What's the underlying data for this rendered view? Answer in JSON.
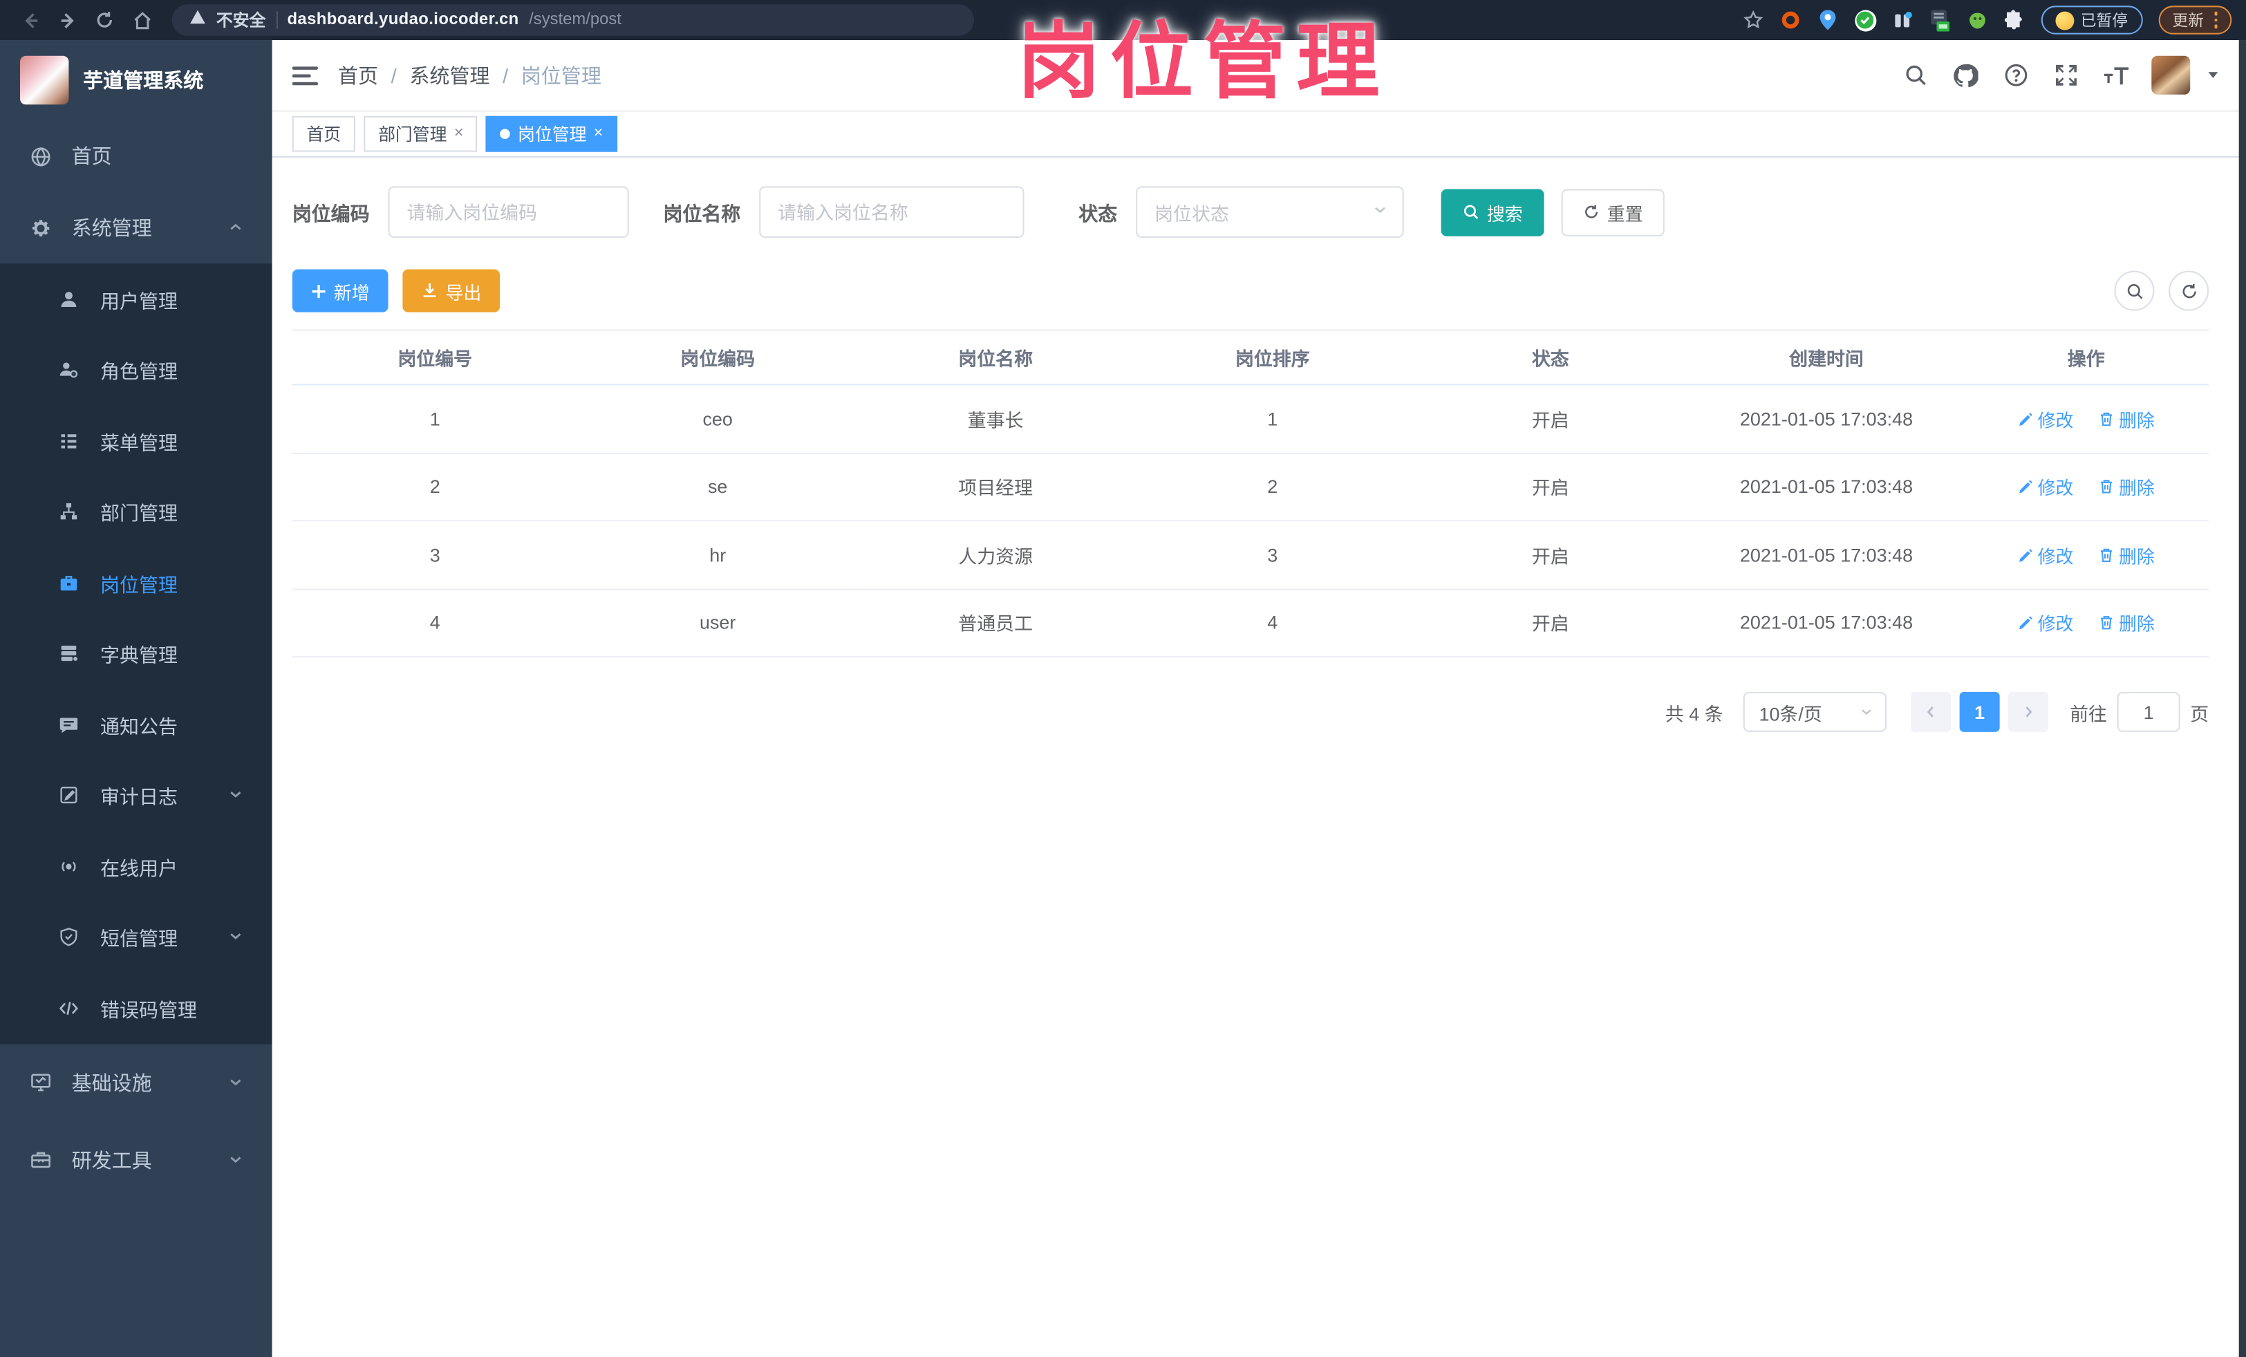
{
  "browser": {
    "security_label": "不安全",
    "url_host": "dashboard.yudao.iocoder.cn",
    "url_path": "/system/post",
    "paused_badge_label": "已暂停",
    "update_button_label": "更新"
  },
  "watermark": {
    "text": "岗位管理",
    "color": "#f4486d"
  },
  "sidebar": {
    "app_title": "芋道管理系统",
    "items_top": [
      {
        "label": "首页"
      },
      {
        "label": "系统管理"
      }
    ],
    "system_children": [
      "用户管理",
      "角色管理",
      "菜单管理",
      "部门管理",
      "岗位管理",
      "字典管理",
      "通知公告",
      "审计日志",
      "在线用户",
      "短信管理",
      "错误码管理"
    ],
    "items_bottom": [
      {
        "label": "基础设施"
      },
      {
        "label": "研发工具"
      }
    ],
    "active_item": "岗位管理"
  },
  "breadcrumb": {
    "items": [
      "首页",
      "系统管理",
      "岗位管理"
    ],
    "separator": "/"
  },
  "tabbar": {
    "close_glyph": "×",
    "tabs": [
      {
        "label": "首页",
        "active": false,
        "closable": false
      },
      {
        "label": "部门管理",
        "active": false,
        "closable": true
      },
      {
        "label": "岗位管理",
        "active": true,
        "closable": true
      }
    ]
  },
  "filter": {
    "code_label": "岗位编码",
    "code_placeholder": "请输入岗位编码",
    "name_label": "岗位名称",
    "name_placeholder": "请输入岗位名称",
    "status_label": "状态",
    "status_placeholder": "岗位状态",
    "search_label": "搜索",
    "reset_label": "重置"
  },
  "toolbar": {
    "add_label": "新增",
    "export_label": "导出"
  },
  "table": {
    "columns": [
      "岗位编号",
      "岗位编码",
      "岗位名称",
      "岗位排序",
      "状态",
      "创建时间",
      "操作"
    ],
    "edit_label": "修改",
    "delete_label": "删除",
    "rows": [
      {
        "no": "1",
        "code": "ceo",
        "name": "董事长",
        "sort": "1",
        "status": "开启",
        "created": "2021-01-05 17:03:48"
      },
      {
        "no": "2",
        "code": "se",
        "name": "项目经理",
        "sort": "2",
        "status": "开启",
        "created": "2021-01-05 17:03:48"
      },
      {
        "no": "3",
        "code": "hr",
        "name": "人力资源",
        "sort": "3",
        "status": "开启",
        "created": "2021-01-05 17:03:48"
      },
      {
        "no": "4",
        "code": "user",
        "name": "普通员工",
        "sort": "4",
        "status": "开启",
        "created": "2021-01-05 17:03:48"
      }
    ]
  },
  "pagination": {
    "total": "共 4 条",
    "page_size": "10条/页",
    "current_page": "1",
    "goto_label": "前往",
    "goto_value": "1",
    "page_unit": "页"
  },
  "colors": {
    "primary": "#409EFF",
    "search_button": "#18a8a0",
    "export_button": "#efa22c",
    "sidebar_bg": "#304156",
    "submenu_bg": "#1f2d3d",
    "watermark": "#f4486d"
  }
}
